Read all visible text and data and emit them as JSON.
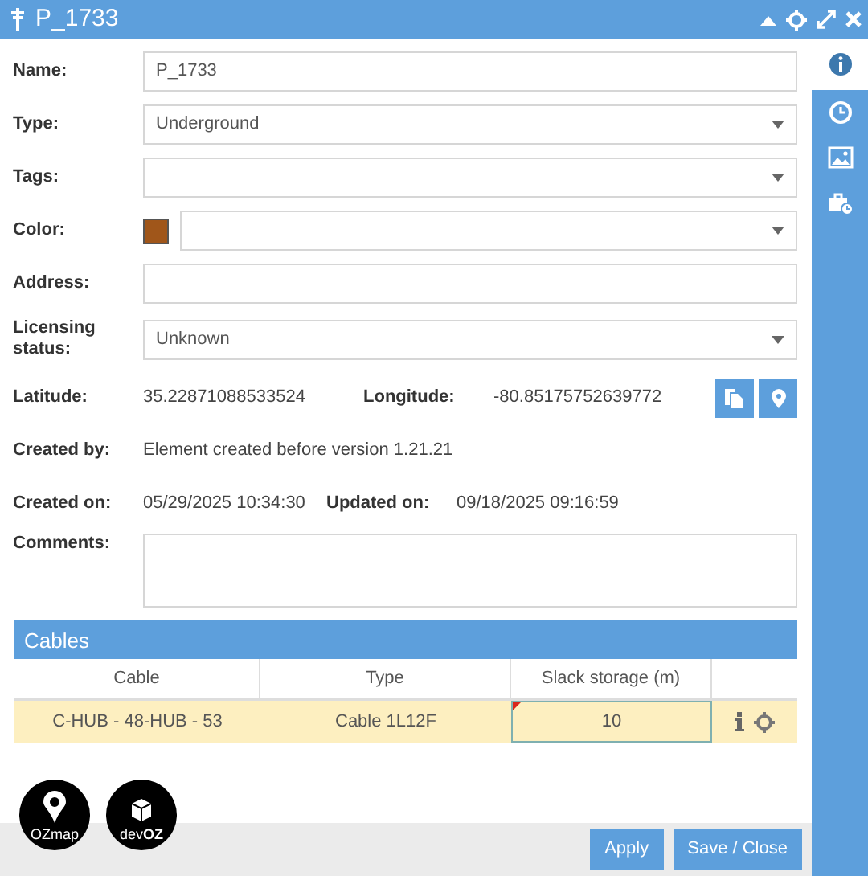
{
  "window": {
    "title": "P_1733"
  },
  "side_tabs": [
    {
      "selected": true
    },
    {
      "selected": false
    },
    {
      "selected": false
    },
    {
      "selected": false
    }
  ],
  "form": {
    "name": {
      "label": "Name:",
      "value": "P_1733"
    },
    "type": {
      "label": "Type:",
      "value": "Underground"
    },
    "tags": {
      "label": "Tags:"
    },
    "color": {
      "label": "Color:",
      "color": "#a0561a"
    },
    "address": {
      "label": "Address:"
    },
    "licensing": {
      "label": "Licensing status:",
      "value": "Unknown"
    },
    "latitude": {
      "label": "Latitude:",
      "value": "35.22871088533524"
    },
    "longitude": {
      "label": "Longitude:",
      "value": "-80.85175752639772"
    },
    "created_by": {
      "label": "Created by:",
      "value": "Element created before version 1.21.21"
    },
    "created_on": {
      "label": "Created on:",
      "value": "05/29/2025 10:34:30"
    },
    "updated_on": {
      "label": "Updated on:",
      "value": "09/18/2025 09:16:59"
    },
    "comments": {
      "label": "Comments:"
    }
  },
  "cables": {
    "title": "Cables",
    "columns": [
      "Cable",
      "Type",
      "Slack storage (m)"
    ],
    "rows": [
      {
        "cable": "C-HUB - 48-HUB - 53",
        "type": "Cable 1L12F",
        "slack": "10",
        "selected": true,
        "modified": true
      }
    ]
  },
  "logos": [
    "OZmap",
    "dev**OZ**"
  ],
  "buttons": [
    "Apply",
    "Save / Close"
  ]
}
